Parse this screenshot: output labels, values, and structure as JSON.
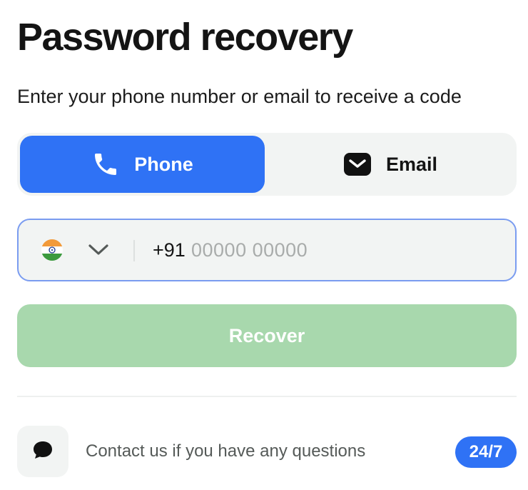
{
  "header": {
    "title": "Password recovery",
    "subtitle": "Enter your phone number or email to receive a code"
  },
  "tabs": [
    {
      "label": "Phone",
      "icon": "phone-icon",
      "active": true
    },
    {
      "label": "Email",
      "icon": "mail-icon",
      "active": false
    }
  ],
  "phone_field": {
    "country_flag": "india-flag-icon",
    "dial_code": "+91",
    "value": "",
    "placeholder": "00000 00000"
  },
  "recover_button": {
    "label": "Recover",
    "enabled": false
  },
  "contact": {
    "text": "Contact us if you have any questions",
    "badge": "24/7",
    "icon": "chat-bubble-icon"
  },
  "colors": {
    "accent": "#2f72f5",
    "recover_disabled": "#a8d8ad",
    "field_border": "#7a9cf0",
    "surface": "#f2f4f3"
  }
}
